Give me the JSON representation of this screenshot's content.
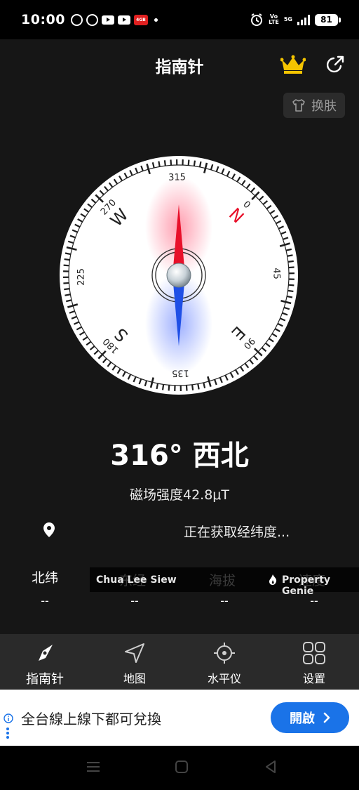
{
  "status_bar": {
    "time": "10:00",
    "red_badge": "4GB",
    "network_top": "Vo",
    "network_bottom": "LTE",
    "signal_label": "5G",
    "battery": "81"
  },
  "header": {
    "title": "指南针",
    "skin_label": "换肤"
  },
  "compass": {
    "heading_deg": 316,
    "dial_numbers": [
      "0",
      "45",
      "90",
      "135",
      "180",
      "225",
      "270",
      "315"
    ],
    "cardinals": {
      "n": "N",
      "e": "E",
      "s": "S",
      "w": "W"
    }
  },
  "readout": {
    "heading": "316° 西北",
    "magnetic": "磁场强度42.8μT",
    "location_status": "正在获取经纬度..."
  },
  "stats": [
    {
      "label": "北纬",
      "value": "--"
    },
    {
      "label": "东经",
      "value": "--"
    },
    {
      "label": "海拔",
      "value": "--"
    },
    {
      "label": "速度",
      "value": "--"
    }
  ],
  "overlay_ads": {
    "left": "Chua Lee Siew",
    "right": "Property Genie"
  },
  "bottom_nav": [
    {
      "label": "指南针",
      "icon": "compass-icon",
      "active": true
    },
    {
      "label": "地图",
      "icon": "navigation-arrow-icon",
      "active": false
    },
    {
      "label": "水平仪",
      "icon": "crosshair-icon",
      "active": false
    },
    {
      "label": "设置",
      "icon": "grid-icon",
      "active": false
    }
  ],
  "ad_banner": {
    "headline": "全台線上線下都可兌換",
    "cta": "開啟"
  },
  "colors": {
    "app_bg": "#161616",
    "nav_bg": "#2a2a2a",
    "needle_north": "#e8102a",
    "needle_south": "#1f4fe6",
    "north_letter": "#e8102a",
    "crown": "#f5c400",
    "cta_blue": "#1a73e8"
  }
}
